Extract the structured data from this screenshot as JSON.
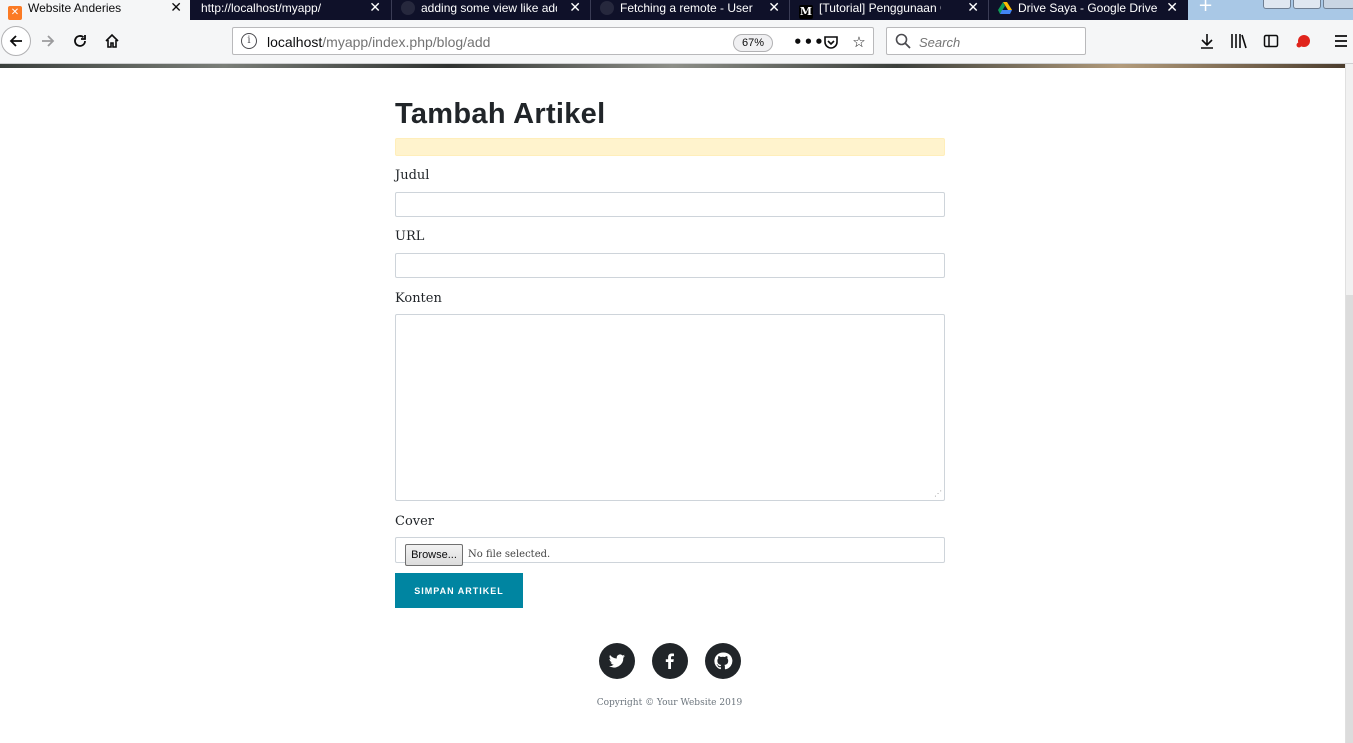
{
  "browser": {
    "tabs": [
      {
        "label": "Website Anderies",
        "icon": "xampp-icon",
        "icon_color": "#fb7a24",
        "active": true
      },
      {
        "label": "http://localhost/myapp/",
        "icon": "",
        "active": false
      },
      {
        "label": "adding some view like add",
        "icon": "github-icon",
        "active": false
      },
      {
        "label": "Fetching a remote - User D",
        "icon": "github-icon",
        "active": false
      },
      {
        "label": "[Tutorial] Penggunaan Git",
        "icon": "medium-icon",
        "active": false
      },
      {
        "label": "Drive Saya - Google Drive",
        "icon": "google-drive-icon",
        "active": false
      }
    ],
    "url_host": "localhost",
    "url_path": "/myapp/index.php/blog/add",
    "zoom": "67%",
    "search_placeholder": "Search"
  },
  "page": {
    "title": "Tambah Artikel",
    "form": {
      "title_label": "Judul",
      "url_label": "URL",
      "content_label": "Konten",
      "cover_label": "Cover",
      "browse_label": "Browse...",
      "no_file_text": "No file selected.",
      "submit_label": "SIMPAN ARTIKEL"
    },
    "footer": {
      "social": [
        "twitter-icon",
        "facebook-icon",
        "github-icon"
      ],
      "copyright": "Copyright © Your Website 2019"
    }
  },
  "colors": {
    "tab_strip": "#0f1129",
    "alert_bg": "#fff3cd",
    "button": "#0085a1",
    "text": "#212529"
  }
}
